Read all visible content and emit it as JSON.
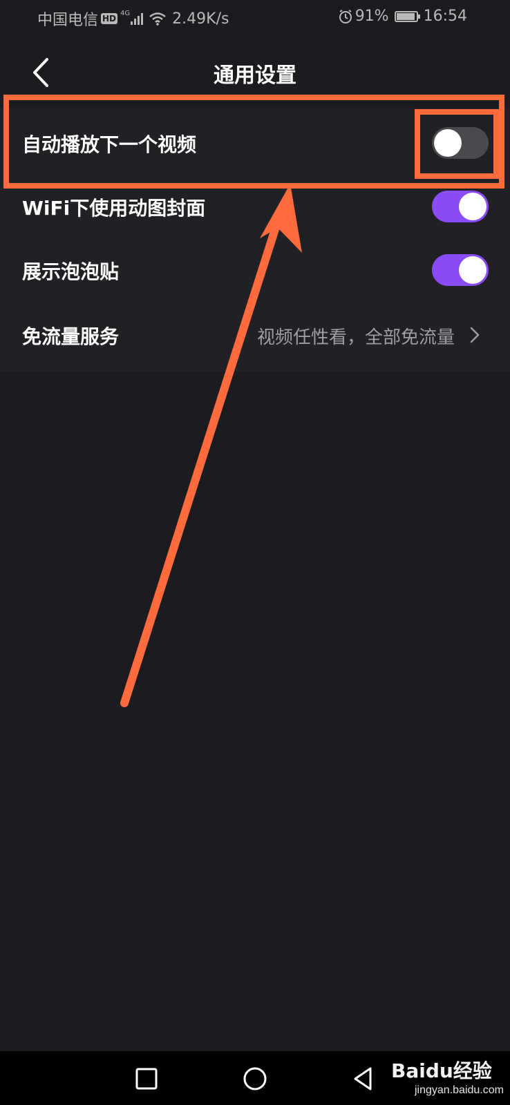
{
  "status_bar": {
    "carrier": "中国电信",
    "hd_badge": "HD",
    "network_type": "4G",
    "speed": "2.49K/s",
    "battery_percent": "91%",
    "time": "16:54",
    "icons": [
      "signal-icon",
      "wifi-icon",
      "alarm-icon",
      "battery-icon"
    ]
  },
  "header": {
    "title": "通用设置",
    "back_icon": "chevron-left-icon"
  },
  "settings": [
    {
      "label": "自动播放下一个视频",
      "type": "toggle",
      "enabled": false
    },
    {
      "label": "WiFi下使用动图封面",
      "type": "toggle",
      "enabled": true
    },
    {
      "label": "展示泡泡贴",
      "type": "toggle",
      "enabled": true
    },
    {
      "label": "免流量服务",
      "type": "link",
      "description": "视频任性看，全部免流量",
      "icon": "chevron-right-icon"
    }
  ],
  "nav_bar": {
    "buttons": [
      "recent-apps-icon",
      "home-icon",
      "back-triangle-icon"
    ]
  },
  "watermark": {
    "brand": "Baidu经验",
    "url": "jingyan.baidu.com"
  },
  "colors": {
    "background": "#1c1b1f",
    "list_background": "#212024",
    "toggle_on": "#8a4cf7",
    "toggle_off": "#4a494e",
    "annotation": "#ff6b3d"
  }
}
